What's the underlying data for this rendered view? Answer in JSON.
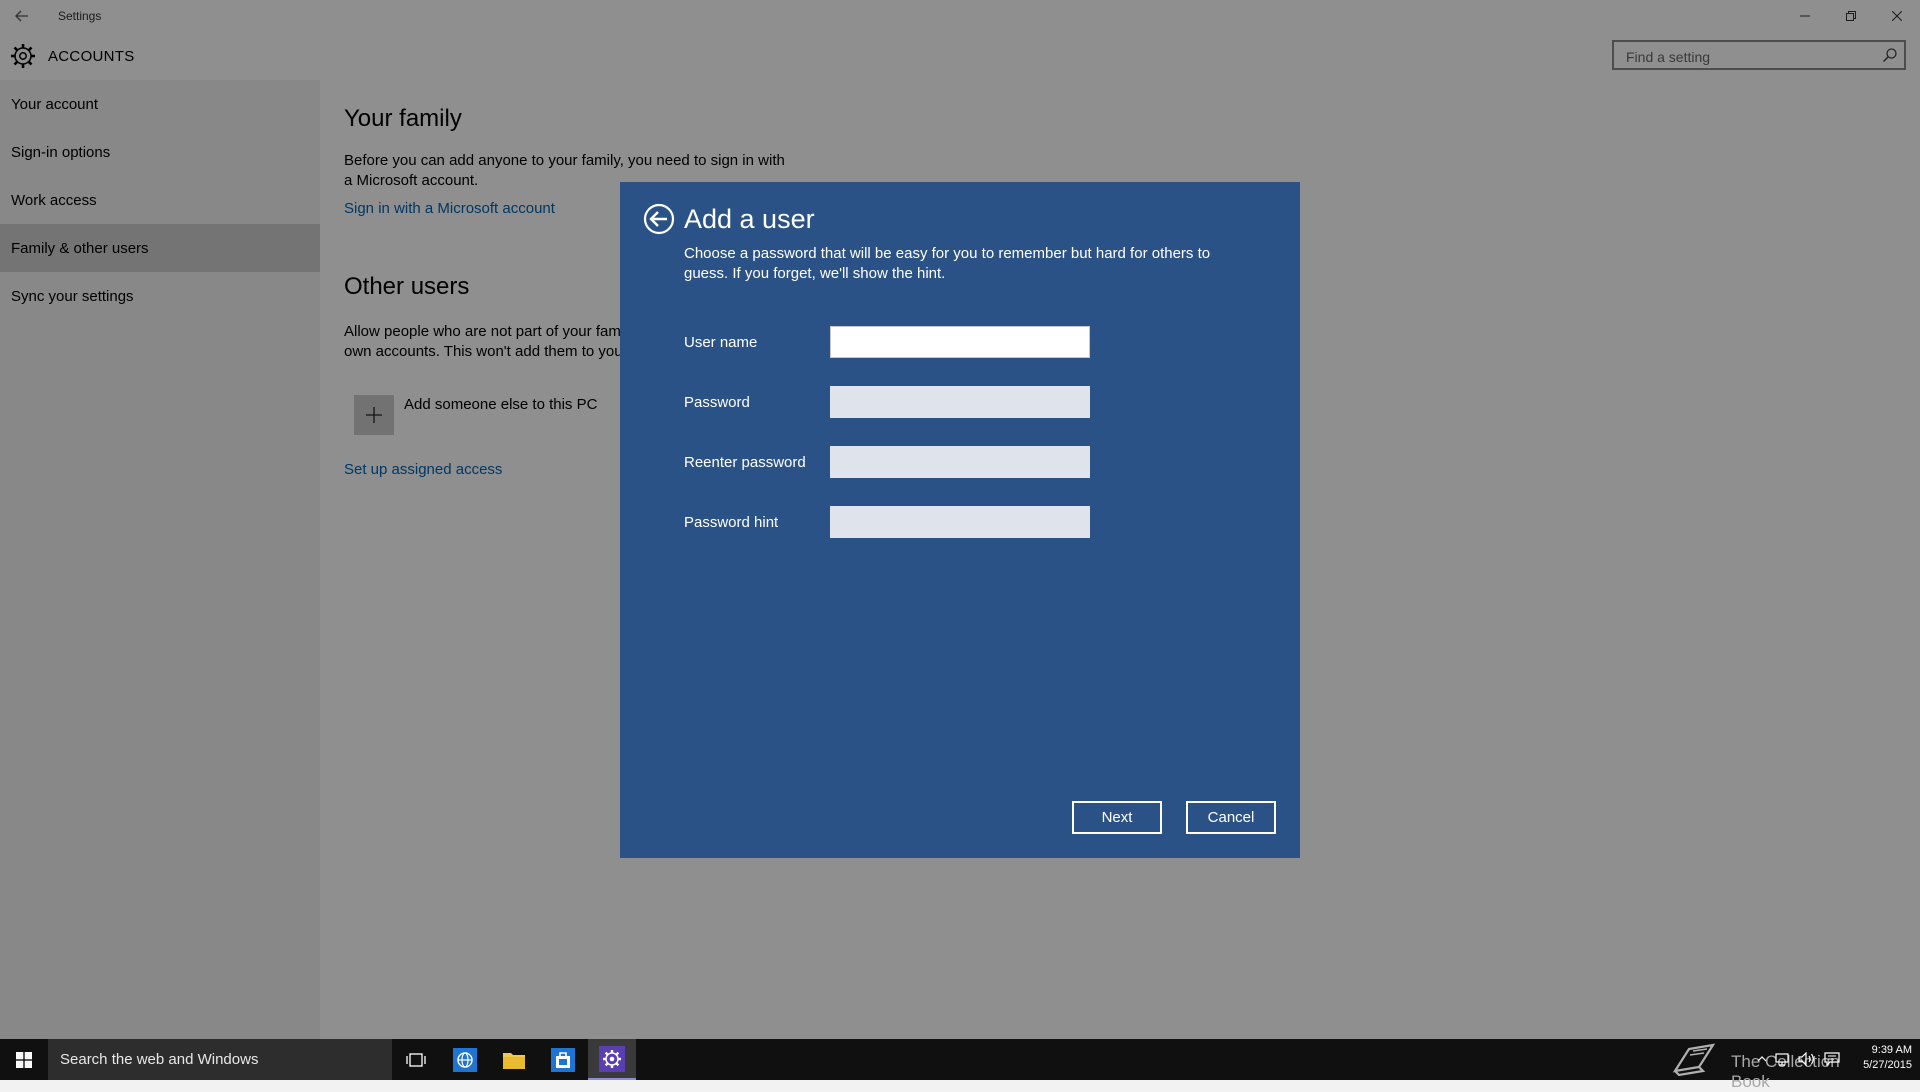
{
  "window": {
    "title": "Settings"
  },
  "header": {
    "title": "ACCOUNTS",
    "search_placeholder": "Find a setting"
  },
  "sidebar": {
    "items": [
      {
        "label": "Your account"
      },
      {
        "label": "Sign-in options"
      },
      {
        "label": "Work access"
      },
      {
        "label": "Family & other users",
        "selected": true
      },
      {
        "label": "Sync your settings"
      }
    ]
  },
  "main": {
    "family": {
      "title": "Your family",
      "desc_line1": "Before you can add anyone to your family, you need to sign in with",
      "desc_line2": "a Microsoft account.",
      "link": "Sign in with a Microsoft account"
    },
    "other": {
      "title": "Other users",
      "desc_line1": "Allow people who are not part of your fam",
      "desc_line2": "own accounts. This won't add them to you",
      "add_label": "Add someone else to this PC",
      "link": "Set up assigned access"
    }
  },
  "dialog": {
    "title": "Add a user",
    "desc": "Choose a password that will be easy for you to remember but hard for others to guess. If you forget, we'll show the hint.",
    "fields": [
      {
        "label": "User name",
        "value": ""
      },
      {
        "label": "Password",
        "value": ""
      },
      {
        "label": "Reenter password",
        "value": ""
      },
      {
        "label": "Password hint",
        "value": ""
      }
    ],
    "next_label": "Next",
    "cancel_label": "Cancel"
  },
  "taskbar": {
    "search_text": "Search the web and Windows",
    "watermark": "The Collection Book",
    "time": "9:39 AM",
    "date": "5/27/2015"
  },
  "colors": {
    "dialog_bg": "#2b5287",
    "link": "#0063b1",
    "selected_nav": "#cfcfcf",
    "taskbar": "#101010"
  }
}
